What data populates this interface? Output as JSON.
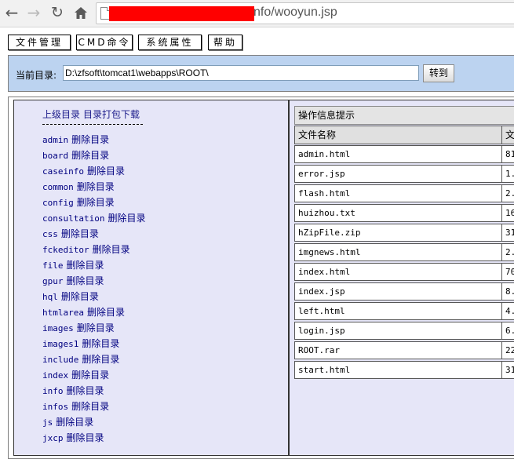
{
  "browser": {
    "url_visible": "nfo/wooyun.jsp",
    "redaction_color": "#ff0000"
  },
  "menu": [
    "文件管理",
    "CMD命令",
    "系统属性",
    "帮助"
  ],
  "path": {
    "label": "当前目录:",
    "value": "D:\\zfsoft\\tomcat1\\webapps\\ROOT\\",
    "goto_label": "转到"
  },
  "left": {
    "parent_dir": "上级目录",
    "pack_download": "目录打包下载",
    "delete_label": "删除目录",
    "dirs": [
      "admin",
      "board",
      "caseinfo",
      "common",
      "config",
      "consultation",
      "css",
      "fckeditor",
      "file",
      "gpur",
      "hql",
      "htmlarea",
      "images",
      "images1",
      "include",
      "index",
      "info",
      "infos",
      "js",
      "jxcp"
    ]
  },
  "right": {
    "info_header": "操作信息提示",
    "col_name": "文件名称",
    "col_second": "文",
    "files": [
      {
        "name": "admin.html",
        "size": "81"
      },
      {
        "name": "error.jsp",
        "size": "1."
      },
      {
        "name": "flash.html",
        "size": "2."
      },
      {
        "name": "huizhou.txt",
        "size": "16"
      },
      {
        "name": "hZipFile.zip",
        "size": "31"
      },
      {
        "name": "imgnews.html",
        "size": "2."
      },
      {
        "name": "index.html",
        "size": "70"
      },
      {
        "name": "index.jsp",
        "size": "8."
      },
      {
        "name": "left.html",
        "size": "4."
      },
      {
        "name": "login.jsp",
        "size": "6."
      },
      {
        "name": "ROOT.rar",
        "size": "22"
      },
      {
        "name": "start.html",
        "size": "31"
      }
    ]
  },
  "colors": {
    "path_panel": "#bcd3f0",
    "panel_bg": "#e6e6f8",
    "link": "#000080"
  }
}
